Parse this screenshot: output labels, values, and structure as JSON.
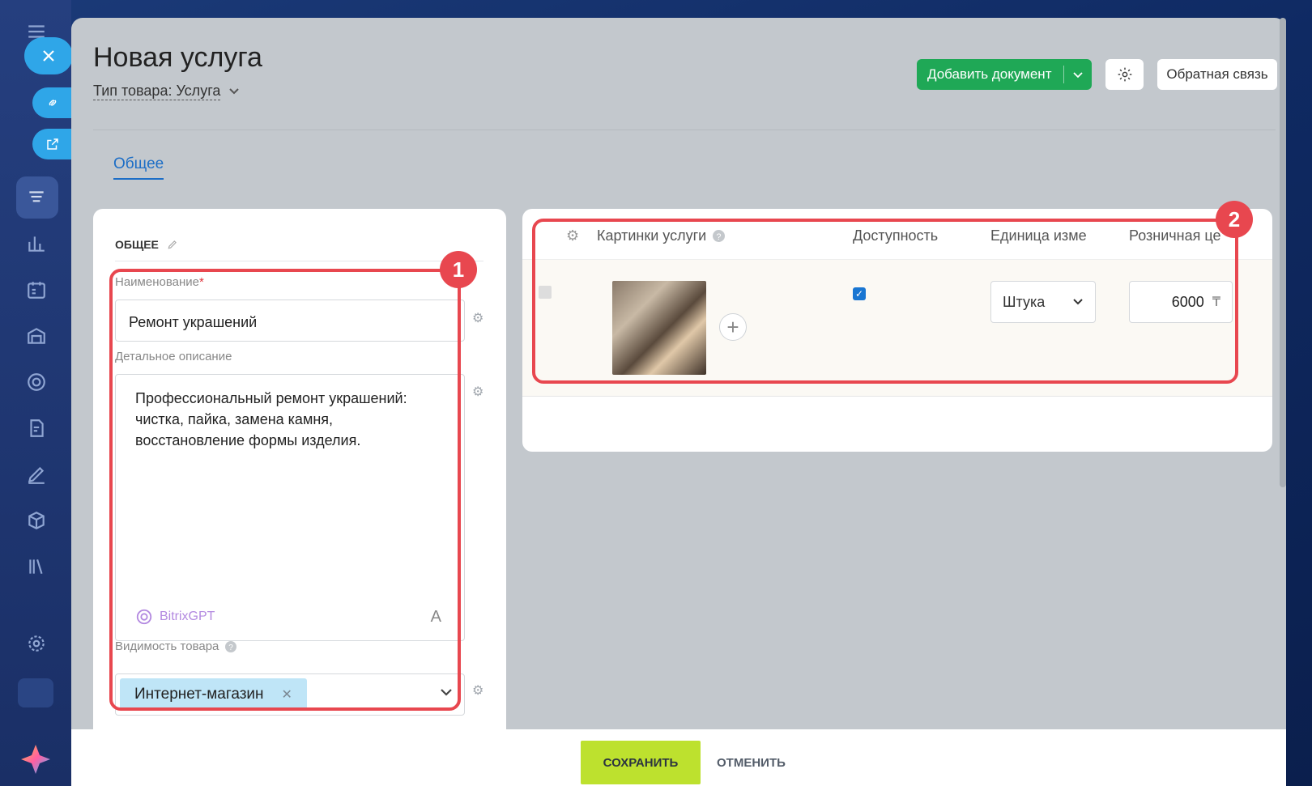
{
  "page": {
    "title": "Новая услуга",
    "type_selector": "Тип товара: Услуга",
    "tab_general": "Общее"
  },
  "toolbar": {
    "add_document": "Добавить документ",
    "feedback": "Обратная связь"
  },
  "general_section": {
    "header": "ОБЩЕЕ",
    "name_label": "Наименование",
    "name_required": "*",
    "name_value": "Ремонт украшений",
    "description_label": "Детальное описание",
    "description_value": "Профессиональный ремонт украшений: чистка, пайка, замена камня, восстановление формы изделия.",
    "gpt_label": "BitrixGPT",
    "format_letter": "A",
    "visibility_label": "Видимость товара",
    "visibility_chip": "Интернет-магазин"
  },
  "table": {
    "headers": {
      "images": "Картинки услуги",
      "availability": "Доступность",
      "unit": "Единица изме",
      "retail_price": "Розничная це"
    },
    "row": {
      "available": true,
      "unit": "Штука",
      "price": "6000",
      "currency": "₸"
    }
  },
  "annotations": {
    "badge_1": "1",
    "badge_2": "2"
  },
  "footer": {
    "save": "СОХРАНИТЬ",
    "cancel": "ОТМЕНИТЬ"
  },
  "colors": {
    "accent_green": "#1fa856",
    "save_lime": "#bde12e",
    "highlight_red": "#e8474f",
    "link_blue": "#1d6ec6"
  }
}
